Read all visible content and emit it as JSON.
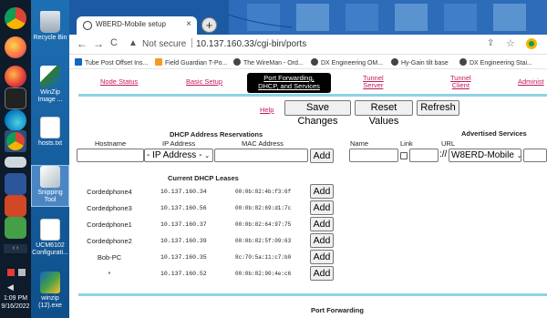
{
  "taskbar": {
    "clock_time": "1:09 PM",
    "clock_date": "9/16/2022"
  },
  "desktop": {
    "icons": [
      {
        "label": "Recycle Bin"
      },
      {
        "label": "WinZip Image ..."
      },
      {
        "label": "hosts.txt"
      },
      {
        "label": "Snipping Tool"
      },
      {
        "label": "UCM6102 Configurati..."
      },
      {
        "label": "winzip (12).exe"
      }
    ]
  },
  "browser": {
    "tab_title": "W8ERD-Mobile setup",
    "tab_close": "×",
    "new_tab": "+",
    "back": "←",
    "forward": "→",
    "reload": "C",
    "security_text": "Not secure",
    "url": "10.137.160.33/cgi-bin/ports",
    "bookmarks": [
      {
        "label": "Tube Post Offset Ins...",
        "color": "#1565c0"
      },
      {
        "label": "Field Guardian T-Po...",
        "color": "#f59a23"
      },
      {
        "label": "The WireMan - Ord...",
        "color": "#444444"
      },
      {
        "label": "DX Engineering OM...",
        "color": "#444444"
      },
      {
        "label": "Hy-Gain tilt base",
        "color": "#444444"
      },
      {
        "label": "DX Engineering Stai...",
        "color": "#444444"
      }
    ]
  },
  "page": {
    "menu": {
      "node_status": "Node Status",
      "basic_setup": "Basic Setup",
      "port_forwarding_line1": "Port Forwarding,",
      "port_forwarding_line2": "DHCP, and Services",
      "tunnel_server_line1": "Tunnel",
      "tunnel_server_line2": "Server",
      "tunnel_client_line1": "Tunnel",
      "tunnel_client_line2": "Client",
      "admin": "Administ"
    },
    "help": "Help",
    "save_changes": "Save Changes",
    "reset_values": "Reset Values",
    "refresh": "Refresh",
    "dhcp_title": "DHCP Address Reservations",
    "dhcp_columns": {
      "hostname": "Hostname",
      "ip": "IP Address",
      "mac": "MAC Address"
    },
    "ip_select": "- IP Address -",
    "add": "Add",
    "advertised_title": "Advertised Services",
    "adv_columns": {
      "name": "Name",
      "link": "Link",
      "url": "URL"
    },
    "url_prefix": "://",
    "service_select": "W8ERD-Mobile",
    "leases_title": "Current DHCP Leases",
    "leases": [
      {
        "host": "Cordedphone4",
        "ip": "10.137.160.34",
        "mac": "00:0b:82:4b:f3:6f",
        "add": "Add"
      },
      {
        "host": "Cordedphone3",
        "ip": "10.137.160.56",
        "mac": "00:0b:82:69:d1:7c",
        "add": "Add"
      },
      {
        "host": "Cordedphone1",
        "ip": "10.137.160.37",
        "mac": "00:0b:82:64:97:75",
        "add": "Add"
      },
      {
        "host": "Cordedphone2",
        "ip": "10.137.160.39",
        "mac": "00:0b:82:5f:09:63",
        "add": "Add"
      },
      {
        "host": "Bob-PC",
        "ip": "10.137.160.35",
        "mac": "8c:70:5a:11:c7:b0",
        "add": "Add"
      },
      {
        "host": "*",
        "ip": "10.137.160.52",
        "mac": "00:0b:82:90:4e:c6",
        "add": "Add"
      }
    ],
    "port_forwarding_heading": "Port Forwarding"
  }
}
